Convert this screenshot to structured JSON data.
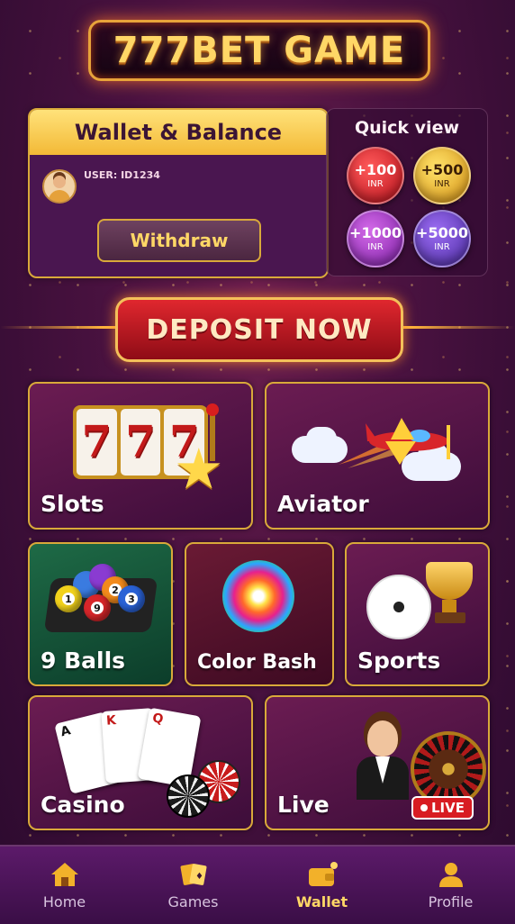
{
  "app": {
    "title": "777BET GAME"
  },
  "wallet": {
    "header": "Wallet & Balance",
    "user_label": "USER: ID1234",
    "withdraw_label": "Withdraw"
  },
  "quick_view": {
    "title": "Quick view",
    "chips": [
      {
        "amount": "+100",
        "currency": "INR",
        "color": "#d8242c"
      },
      {
        "amount": "+500",
        "currency": "INR",
        "color": "#f2b12a"
      },
      {
        "amount": "+1000",
        "currency": "INR",
        "color": "#a83cc8"
      },
      {
        "amount": "+5000",
        "currency": "INR",
        "color": "#6a44c8"
      }
    ]
  },
  "deposit": {
    "label": "DEPOSIT NOW"
  },
  "games": [
    {
      "label": "Slots",
      "icon": "slot-machine-icon"
    },
    {
      "label": "Aviator",
      "icon": "airplane-icon"
    },
    {
      "label": "9 Balls",
      "icon": "billiard-balls-icon"
    },
    {
      "label": "Color Bash",
      "icon": "color-splash-icon"
    },
    {
      "label": "Sports",
      "icon": "soccer-trophy-icon"
    },
    {
      "label": "Casino",
      "icon": "cards-chips-icon"
    },
    {
      "label": "Live",
      "icon": "live-dealer-icon",
      "badge": "LIVE"
    }
  ],
  "slots_reels": [
    "7",
    "7",
    "7"
  ],
  "billiard_balls": [
    "1",
    "2",
    "3",
    "9"
  ],
  "playing_cards": [
    "A",
    "K",
    "Q"
  ],
  "nav": [
    {
      "label": "Home",
      "icon": "home-icon"
    },
    {
      "label": "Games",
      "icon": "cards-icon"
    },
    {
      "label": "Wallet",
      "icon": "wallet-icon",
      "active": true
    },
    {
      "label": "Profile",
      "icon": "profile-icon"
    }
  ],
  "colors": {
    "accent_gold": "#ffd766",
    "bg_purple": "#4a1240",
    "deposit_red": "#d81c22"
  }
}
